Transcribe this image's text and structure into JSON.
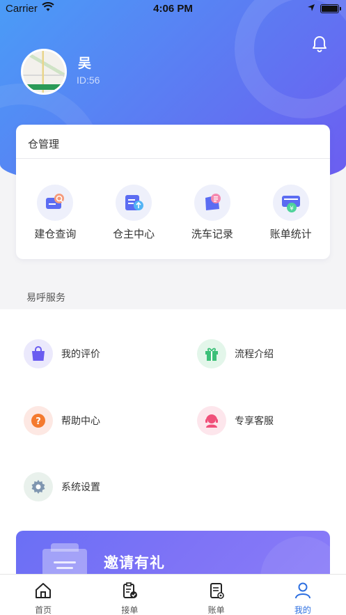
{
  "status_bar": {
    "carrier": "Carrier",
    "time": "4:06 PM"
  },
  "profile": {
    "name": "吴",
    "id": "ID:56"
  },
  "warehouse": {
    "title": "仓管理",
    "items": [
      {
        "label": "建仓查询",
        "icon": "warehouse-search-icon"
      },
      {
        "label": "仓主中心",
        "icon": "owner-center-icon"
      },
      {
        "label": "洗车记录",
        "icon": "wash-record-icon"
      },
      {
        "label": "账单统计",
        "icon": "bill-stats-icon"
      }
    ]
  },
  "services": {
    "title": "易呼服务",
    "items": [
      {
        "label": "我的评价",
        "icon": "shopping-bag-icon"
      },
      {
        "label": "流程介绍",
        "icon": "gift-icon"
      },
      {
        "label": "帮助中心",
        "icon": "help-icon"
      },
      {
        "label": "专享客服",
        "icon": "customer-service-icon"
      },
      {
        "label": "系统设置",
        "icon": "gear-icon"
      }
    ]
  },
  "invite": {
    "text": "邀请有礼"
  },
  "tabbar": {
    "active": "我的",
    "items": [
      {
        "label": "首页",
        "icon": "home-icon"
      },
      {
        "label": "接单",
        "icon": "clipboard-check-icon"
      },
      {
        "label": "账单",
        "icon": "bill-icon"
      },
      {
        "label": "我的",
        "icon": "user-icon"
      }
    ]
  },
  "colors": {
    "primary": "#2d6fe0",
    "gradient_start": "#4a9cf7",
    "gradient_end": "#6d5cf0"
  }
}
